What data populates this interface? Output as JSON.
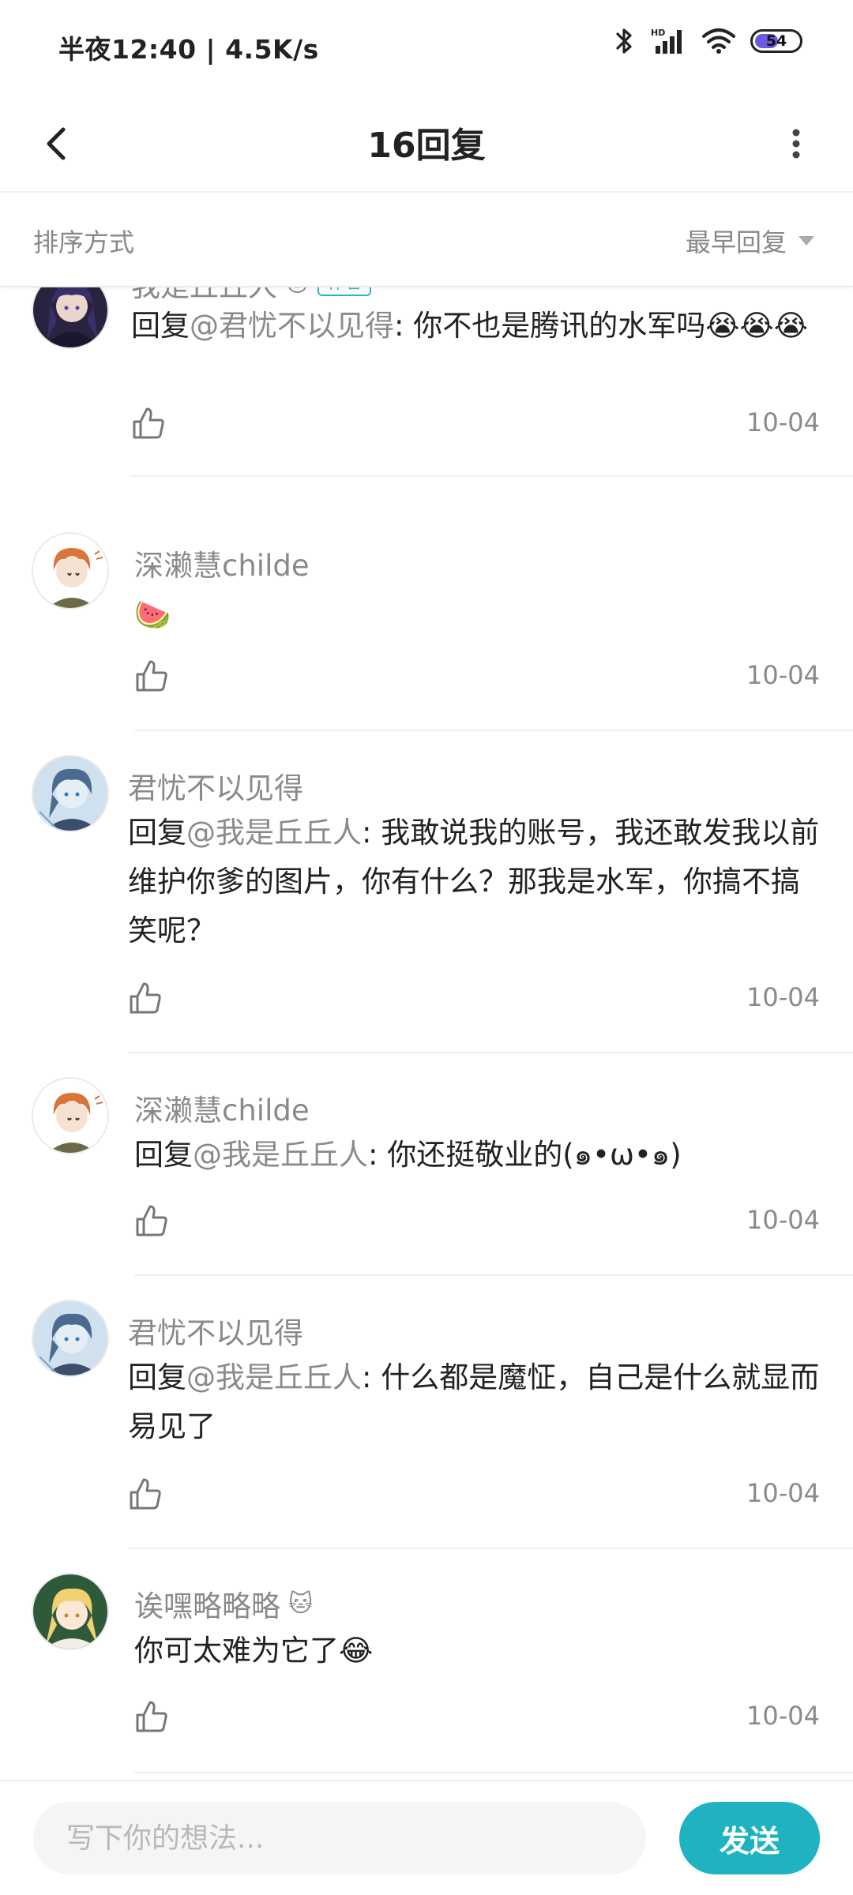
{
  "status_bar": {
    "time_speed": "半夜12:40 | 4.5K/s",
    "battery": "54",
    "battery_level": 0.54,
    "icons": [
      "bluetooth-icon",
      "hd-signal-icon",
      "wifi-icon",
      "battery-icon"
    ]
  },
  "header": {
    "title": "16回复"
  },
  "sort": {
    "label": "排序方式",
    "selected": "最早回复"
  },
  "comments": [
    {
      "username": "我是丘丘人",
      "badge": "作者",
      "reply_prefix": "回复",
      "mention": "@君忧不以见得",
      "separator": ": ",
      "text": "你不也是腾讯的水军吗",
      "emojis": "😭😭😭",
      "date": "10-04"
    },
    {
      "username": "深濑慧childe",
      "text": "🍉",
      "date": "10-04"
    },
    {
      "username": "君忧不以见得",
      "reply_prefix": "回复",
      "mention": "@我是丘丘人",
      "separator": ": ",
      "text": "我敢说我的账号，我还敢发我以前维护你爹的图片，你有什么？那我是水军，你搞不搞笑呢？",
      "date": "10-04"
    },
    {
      "username": "深濑慧childe",
      "reply_prefix": "回复",
      "mention": "@我是丘丘人",
      "separator": ": ",
      "text": "你还挺敬业的(๑•ω•๑)",
      "date": "10-04"
    },
    {
      "username": "君忧不以见得",
      "reply_prefix": "回复",
      "mention": "@我是丘丘人",
      "separator": ": ",
      "text": "什么都是魔怔，自己是什么就显而易见了",
      "date": "10-04"
    },
    {
      "username": "诶嘿略略略",
      "text": "你可太难为它了",
      "emoji": "😂",
      "date": "10-04"
    }
  ],
  "input": {
    "placeholder": "写下你的想法...",
    "send_label": "发送"
  },
  "colors": {
    "accent": "#1fb3c2",
    "muted_text": "#8a8a8a",
    "body_text": "#222222"
  }
}
